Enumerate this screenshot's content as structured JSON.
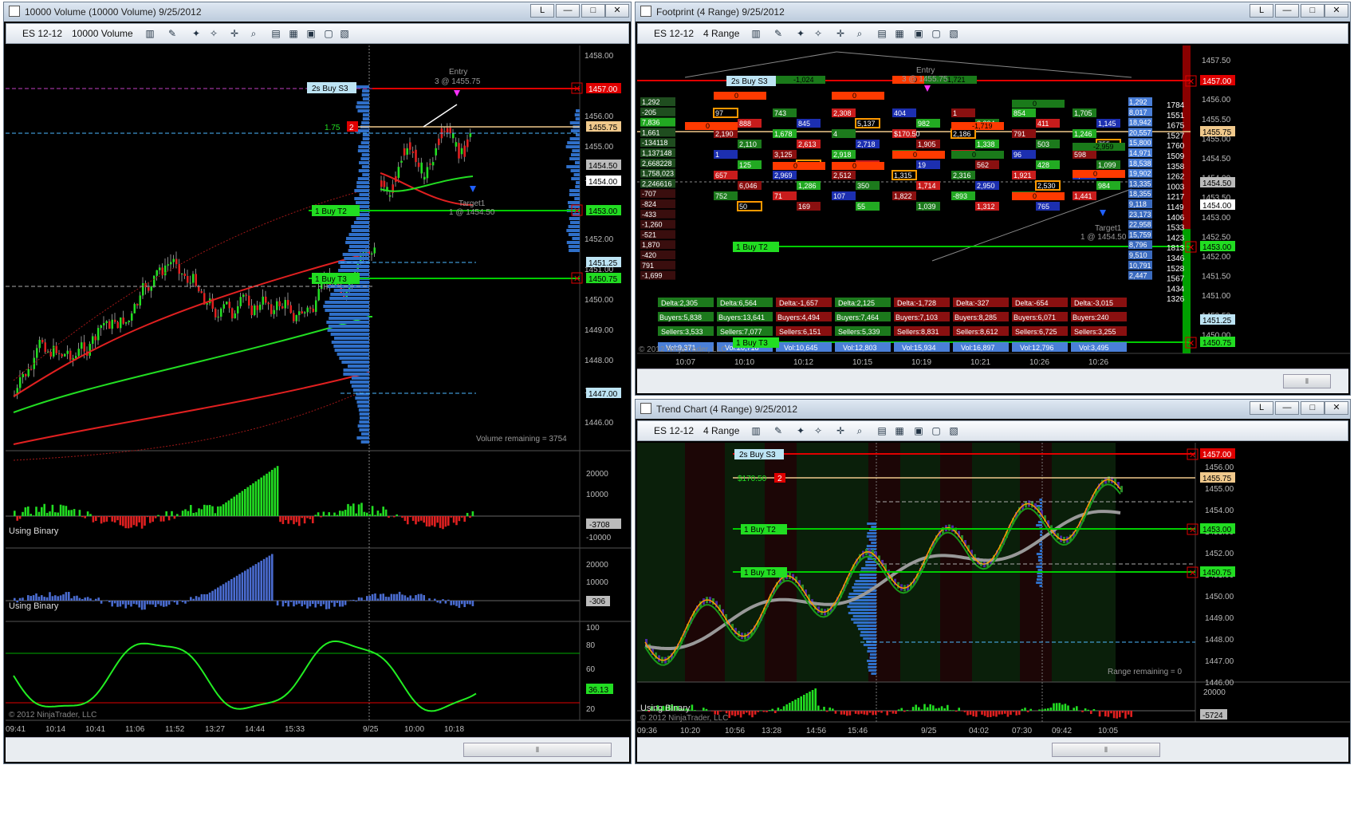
{
  "left": {
    "title": "10000 Volume (10000 Volume)  9/25/2012",
    "instrument": "ES 12-12",
    "period": "10000 Volume",
    "btn_layout": "L",
    "btn_min": "—",
    "btn_max": "□",
    "btn_close": "✕",
    "price_axis": [
      "1458.00",
      "1456.00",
      "1455.00",
      "1453.00",
      "1452.00",
      "1451.00",
      "1450.00",
      "1449.00",
      "1448.00",
      "1447.00",
      "1446.00"
    ],
    "price_flags": {
      "s3": "1457.00",
      "cur": "1455.75",
      "a": "1454.50",
      "b": "1454.00",
      "t2": "1453.00",
      "c": "1451.25",
      "t3": "1450.75",
      "d": "1447.00"
    },
    "order_s3": "2s  Buy S3",
    "order_t2": "1  Buy T2",
    "order_t3": "1  Buy T3",
    "pos_price": "1.75",
    "pos_qty": "2",
    "entry_label": "Entry",
    "entry_detail": "3 @ 1455.75",
    "target_label": "Target1",
    "target_detail": "1 @ 1454.50",
    "volume_remaining": "Volume remaining = 3754",
    "panel2_label": "Using Binary",
    "panel2_axis": [
      "20000",
      "10000",
      "-10000"
    ],
    "panel2_flag": "-3708",
    "panel3_label": "Using Binary",
    "panel3_axis": [
      "20000",
      "10000",
      "0"
    ],
    "panel3_flag": "-306",
    "panel4_axis": [
      "100",
      "80",
      "60",
      "40",
      "20"
    ],
    "panel4_flag": "36.13",
    "copyright": "© 2012 NinjaTrader, LLC",
    "time_axis": [
      "09:41",
      "10:14",
      "10:41",
      "11:06",
      "11:52",
      "13:27",
      "14:44",
      "15:33",
      "9/25",
      "10:00",
      "10:18"
    ]
  },
  "footprint": {
    "title": "Footprint (4 Range)  9/25/2012",
    "instrument": "ES 12-12",
    "period": "4 Range",
    "btn_layout": "L",
    "btn_min": "—",
    "btn_max": "□",
    "btn_close": "✕",
    "price_axis": [
      "1457.50",
      "1456.50",
      "1456.00",
      "1455.50",
      "1455.00",
      "1454.50",
      "1454.00",
      "1453.50",
      "1453.00",
      "1452.50",
      "1452.00",
      "1451.50",
      "1451.00",
      "1450.50",
      "1450.00"
    ],
    "price_flags": {
      "s3": "1457.00",
      "cur": "1455.75",
      "a": "1454.50",
      "b": "1454.00",
      "t2": "1453.00",
      "c": "1451.25",
      "t3": "1450.75"
    },
    "order_s3": "2s  Buy S3",
    "order_t2": "1  Buy T2",
    "order_t3": "1  Buy T3",
    "entry_label": "Entry",
    "entry_detail": "3 @ 1455.75",
    "target_label": "Target1",
    "target_detail": "1 @ 1454.50",
    "pnl": "$170.50",
    "left_column": [
      "1,292",
      "-205",
      "7,836",
      "1,661",
      "-134118",
      "1,137148",
      "2,668228",
      "1,758,023",
      "2,246616",
      "-707",
      "-824",
      "-433",
      "-1,260",
      "-521",
      "1,870",
      "-420",
      "791",
      "-1,699"
    ],
    "right_column": [
      "1784",
      "1551",
      "1675",
      "1527",
      "1760",
      "1509",
      "1358",
      "1262",
      "1003",
      "1217",
      "1149",
      "1406",
      "1533",
      "1423",
      "1813",
      "1346",
      "1528",
      "1567",
      "1434",
      "1326"
    ],
    "right_vol": [
      "1,292",
      "8,017",
      "18,942",
      "20,557",
      "15,800",
      "14,971",
      "18,538",
      "19,902",
      "13,335",
      "18,355",
      "9,118",
      "23,173",
      "22,958",
      "15,759",
      "8,796",
      "9,510",
      "10,791",
      "2,447"
    ],
    "cells": [
      "97",
      "743",
      "2,308",
      "404",
      "1",
      "854",
      "1,705",
      "888",
      "845",
      "5,137",
      "982",
      "2,334",
      "411",
      "1,145",
      "2,190",
      "1,678",
      "4",
      "$170.50",
      "2,186",
      "791",
      "1,246",
      "2,110",
      "2,613",
      "2,718",
      "1,905",
      "1,338",
      "503",
      "755",
      "1",
      "3,125",
      "2,918",
      "2,123",
      "489",
      "96",
      "598",
      "125",
      "1,095",
      "904",
      "19",
      "562",
      "428",
      "1,099",
      "657",
      "2,969",
      "2,512",
      "1,315",
      "2,316",
      "1,921",
      "4,780",
      "6,046",
      "1,286",
      "350",
      "1,714",
      "2,950",
      "2,530",
      "984",
      "752",
      "71",
      "107",
      "1,822",
      "-893",
      "64",
      "1,441",
      "50",
      "169",
      "55",
      "1,039",
      "1,312",
      "765"
    ],
    "bars": [
      "0",
      "0",
      "-1,024",
      "0",
      "0",
      "-1,721",
      "0",
      "-1,719",
      "0",
      "0",
      "0",
      "-2,959",
      "0",
      "0",
      "0"
    ],
    "summary": [
      {
        "delta": "Delta:2,305",
        "buyers": "Buyers:5,838",
        "sellers": "Sellers:3,533",
        "vol": "Vol:9,371"
      },
      {
        "delta": "Delta:6,564",
        "buyers": "Buyers:13,641",
        "sellers": "Sellers:7,077",
        "vol": "Vol:20,718"
      },
      {
        "delta": "Delta:-1,657",
        "buyers": "Buyers:4,494",
        "sellers": "Sellers:6,151",
        "vol": "Vol:10,645"
      },
      {
        "delta": "Delta:2,125",
        "buyers": "Buyers:7,464",
        "sellers": "Sellers:5,339",
        "vol": "Vol:12,803"
      },
      {
        "delta": "Delta:-1,728",
        "buyers": "Buyers:7,103",
        "sellers": "Sellers:8,831",
        "vol": "Vol:15,934"
      },
      {
        "delta": "Delta:-327",
        "buyers": "Buyers:8,285",
        "sellers": "Sellers:8,612",
        "vol": "Vol:16,897"
      },
      {
        "delta": "Delta:-654",
        "buyers": "Buyers:6,071",
        "sellers": "Sellers:6,725",
        "vol": "Vol:12,796"
      },
      {
        "delta": "Delta:-3,015",
        "buyers": "Buyers:240",
        "sellers": "Sellers:3,255",
        "vol": "Vol:3,495"
      }
    ],
    "copyright": "© 2012 NinjaTrader, LLC",
    "time_axis": [
      "10:07",
      "10:10",
      "10:12",
      "10:15",
      "10:19",
      "10:21",
      "10:26",
      "10:26"
    ]
  },
  "trend": {
    "title": "Trend Chart (4 Range)  9/25/2012",
    "instrument": "ES 12-12",
    "period": "4 Range",
    "btn_layout": "L",
    "btn_min": "—",
    "btn_max": "□",
    "btn_close": "✕",
    "price_axis": [
      "1456.00",
      "1455.00",
      "1454.00",
      "1453.00",
      "1452.00",
      "1451.00",
      "1450.00",
      "1449.00",
      "1448.00",
      "1447.00",
      "1446.00"
    ],
    "price_flags": {
      "s3": "1457.00",
      "cur": "1455.75",
      "t2": "1453.00",
      "t3": "1450.75"
    },
    "order_s3": "2s  Buy S3",
    "order_t2": "1  Buy T2",
    "order_t3": "1  Buy T3",
    "pnl": "$170.50",
    "pos_qty": "2",
    "range_remaining": "Range remaining = 0",
    "lower_label": "Using Binary",
    "lower_axis": "20000",
    "lower_flag": "-5724",
    "copyright": "© 2012 NinjaTrader, LLC",
    "time_axis": [
      "09:36",
      "10:20",
      "10:56",
      "13:28",
      "14:56",
      "15:46",
      "9/25",
      "04:02",
      "07:30",
      "09:42",
      "10:05"
    ]
  },
  "colors": {
    "up": "#22dd22",
    "down": "#e02020",
    "order_red": "#e00000",
    "order_green": "#00cc00",
    "vol_blue": "#2f6fc8",
    "current": "#f0c98c"
  }
}
